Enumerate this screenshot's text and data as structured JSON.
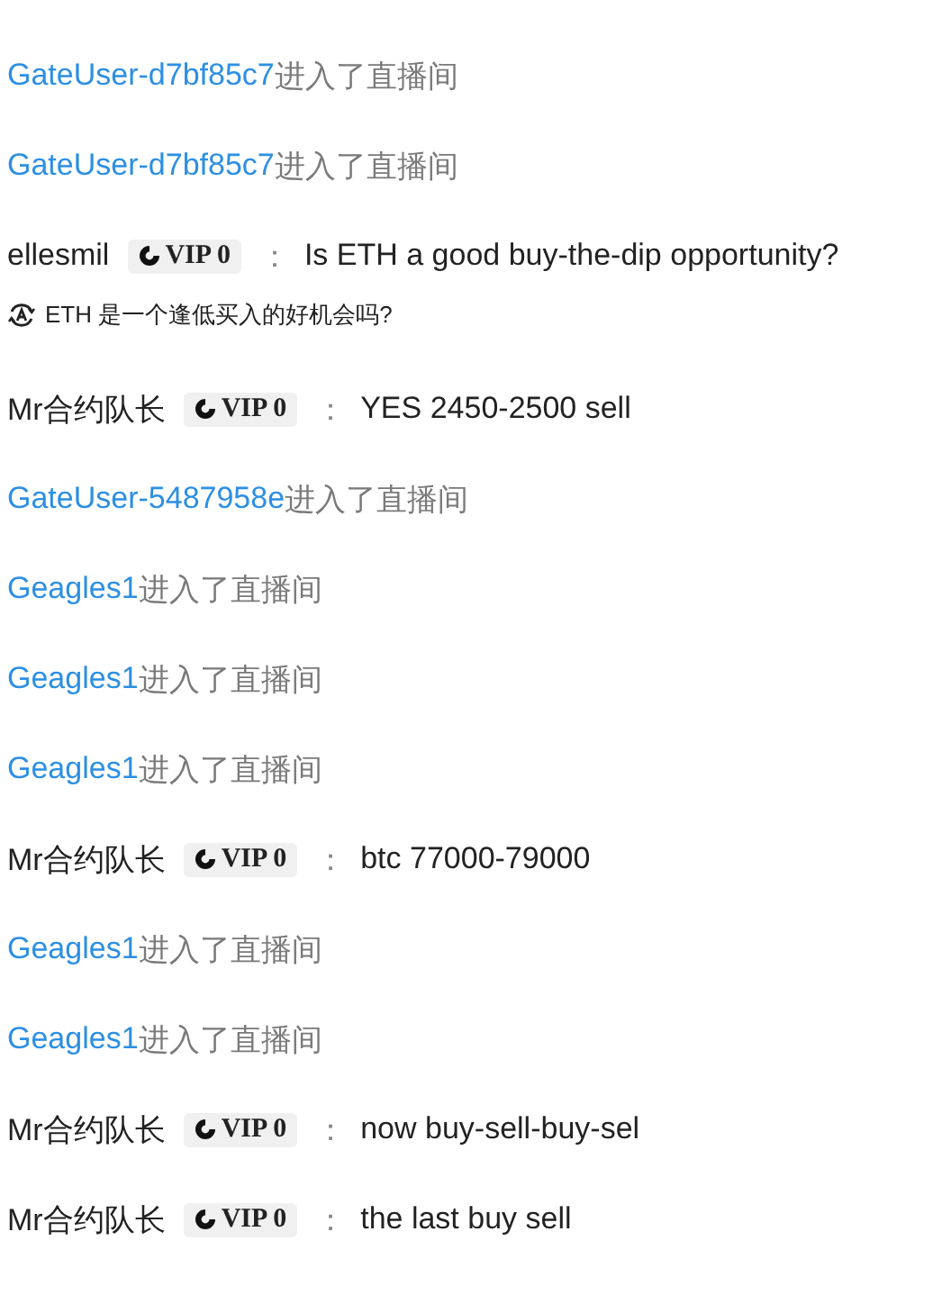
{
  "messages": [
    {
      "kind": "join",
      "user": "GateUser-d7bf85c7",
      "text": "进入了直播间"
    },
    {
      "kind": "join",
      "user": "GateUser-d7bf85c7",
      "text": "进入了直播间"
    },
    {
      "kind": "chat",
      "user": "ellesmil",
      "badge": "VIP 0",
      "separator": "：",
      "text": "Is ETH a good buy-the-dip opportunity?",
      "translation": "ETH 是一个逢低买入的好机会吗?"
    },
    {
      "kind": "chat",
      "user": "Mr合约队长",
      "badge": "VIP 0",
      "separator": "：",
      "text": "YES 2450-2500 sell"
    },
    {
      "kind": "join",
      "user": "GateUser-5487958e",
      "text": "进入了直播间"
    },
    {
      "kind": "join",
      "user": "Geagles1",
      "text": "进入了直播间"
    },
    {
      "kind": "join",
      "user": "Geagles1",
      "text": "进入了直播间"
    },
    {
      "kind": "join",
      "user": "Geagles1",
      "text": "进入了直播间"
    },
    {
      "kind": "chat",
      "user": "Mr合约队长",
      "badge": "VIP 0",
      "separator": "：",
      "text": "btc 77000-79000"
    },
    {
      "kind": "join",
      "user": "Geagles1",
      "text": "进入了直播间"
    },
    {
      "kind": "join",
      "user": "Geagles1",
      "text": "进入了直播间"
    },
    {
      "kind": "chat",
      "user": "Mr合约队长",
      "badge": "VIP 0",
      "separator": "：",
      "text": "now buy-sell-buy-sel"
    },
    {
      "kind": "chat",
      "user": "Mr合约队长",
      "badge": "VIP 0",
      "separator": "：",
      "text": "the last buy sell"
    }
  ]
}
